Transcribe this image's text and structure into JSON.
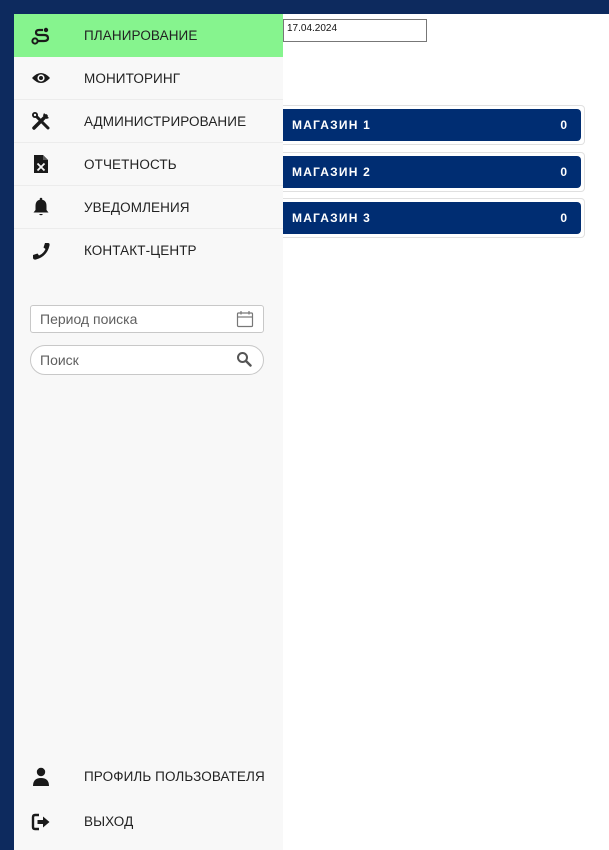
{
  "sidebar": {
    "nav": [
      {
        "label": "ПЛАНИРОВАНИЕ",
        "icon": "route-icon",
        "active": true
      },
      {
        "label": "МОНИТОРИНГ",
        "icon": "eye-icon",
        "active": false
      },
      {
        "label": "АДМИНИСТРИРОВАНИЕ",
        "icon": "tools-icon",
        "active": false
      },
      {
        "label": "ОТЧЕТНОСТЬ",
        "icon": "excel-file-icon",
        "active": false
      },
      {
        "label": "УВЕДОМЛЕНИЯ",
        "icon": "bell-icon",
        "active": false
      },
      {
        "label": "КОНТАКТ-ЦЕНТР",
        "icon": "phone-icon",
        "active": false
      }
    ],
    "period_placeholder": "Период поиска",
    "search_placeholder": "Поиск",
    "bottom": [
      {
        "label": "ПРОФИЛЬ ПОЛЬЗОВАТЕЛЯ",
        "icon": "user-icon"
      },
      {
        "label": "ВЫХОД",
        "icon": "logout-icon"
      }
    ]
  },
  "main": {
    "date_value": "17.04.2024",
    "stores": [
      {
        "name": "МАГАЗИН 1",
        "count": "0"
      },
      {
        "name": "МАГАЗИН 2",
        "count": "0"
      },
      {
        "name": "МАГАЗИН 3",
        "count": "0"
      }
    ]
  },
  "colors": {
    "frame": "#0d2a5e",
    "active_nav": "#86f48e",
    "store_bar": "#002d72",
    "sidebar_bg": "#f8f8f8"
  }
}
